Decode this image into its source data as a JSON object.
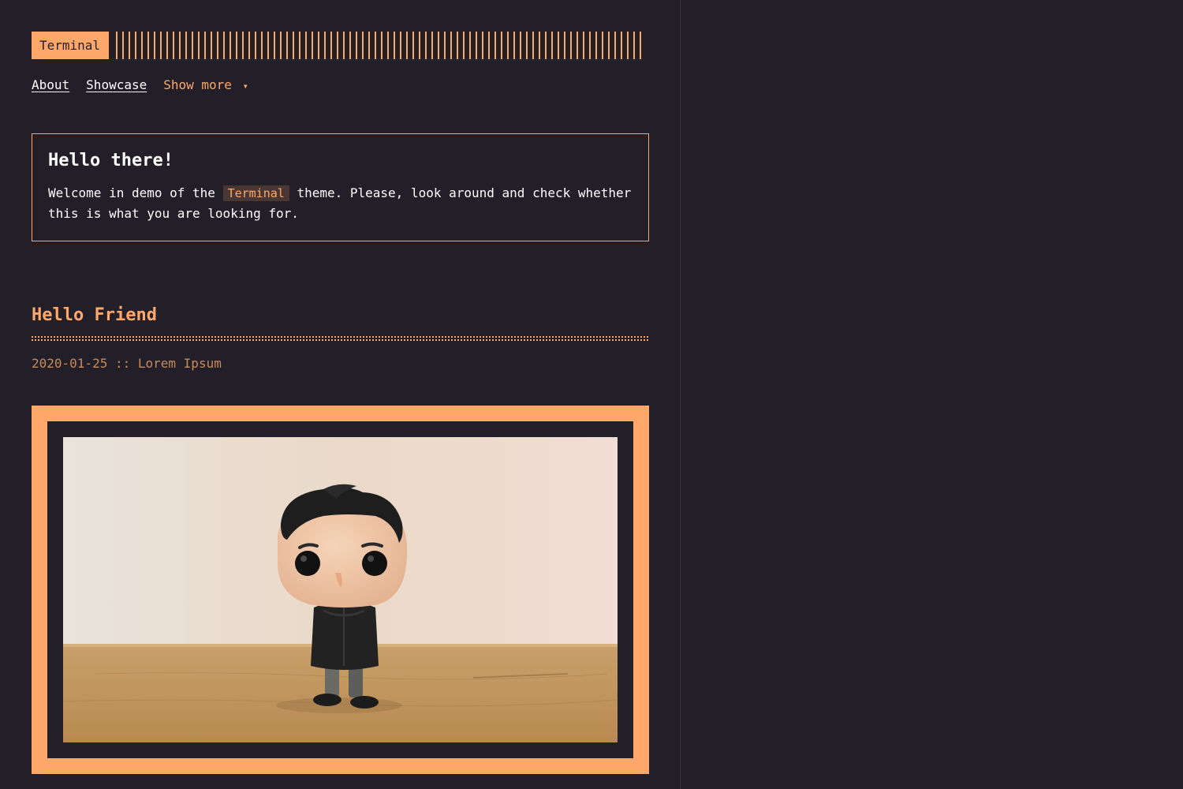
{
  "header": {
    "logo": "Terminal"
  },
  "nav": {
    "items": [
      {
        "label": "About"
      },
      {
        "label": "Showcase"
      }
    ],
    "more_label": "Show more",
    "more_caret": "▾"
  },
  "intro": {
    "title": "Hello there!",
    "text_before": "Welcome in demo of the ",
    "code": "Terminal",
    "text_after": " theme. Please, look around and check whether this is what you are looking for."
  },
  "post": {
    "title": "Hello Friend",
    "date": "2020-01-25",
    "separator": "::",
    "author": "Lorem Ipsum"
  },
  "colors": {
    "background": "#221f29",
    "accent": "#ffa86a",
    "text": "#ffffff"
  }
}
